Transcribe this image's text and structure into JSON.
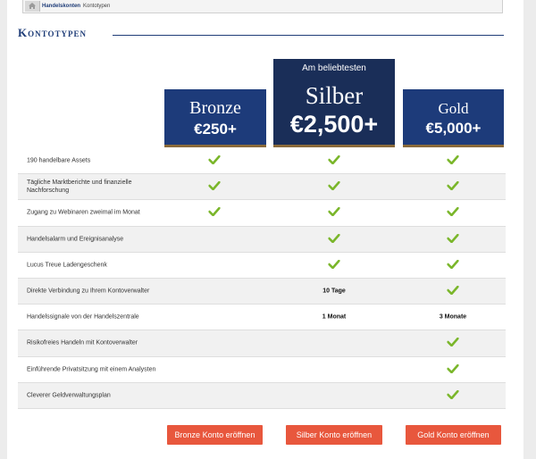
{
  "breadcrumb": {
    "items": [
      "Handelskonten",
      "Kontotypen"
    ]
  },
  "page_title": "Kontotypen",
  "tiers": [
    {
      "name": "Bronze",
      "price": "€250+"
    },
    {
      "name": "Silber",
      "price": "€2,500+",
      "ribbon": "Am beliebtesten"
    },
    {
      "name": "Gold",
      "price": "€5,000+"
    }
  ],
  "features": [
    {
      "label": "190 handelbare Assets",
      "values": [
        "check",
        "check",
        "check"
      ]
    },
    {
      "label": "Tägliche Marktberichte und finanzielle Nachforschung",
      "values": [
        "check",
        "check",
        "check"
      ]
    },
    {
      "label": "Zugang zu Webinaren zweimal im Monat",
      "values": [
        "check",
        "check",
        "check"
      ]
    },
    {
      "label": "Handelsalarm und Ereignisanalyse",
      "values": [
        "",
        "check",
        "check"
      ]
    },
    {
      "label": "Lucus Treue Ladengeschenk",
      "values": [
        "",
        "check",
        "check"
      ]
    },
    {
      "label": "Direkte Verbindung zu Ihrem Kontoverwalter",
      "values": [
        "",
        "10 Tage",
        "check"
      ]
    },
    {
      "label": "Handelssignale von der Handelszentrale",
      "values": [
        "",
        "1 Monat",
        "3 Monate"
      ]
    },
    {
      "label": "Risikofreies Handeln mit Kontoverwalter",
      "values": [
        "",
        "",
        "check"
      ]
    },
    {
      "label": "Einführende Privatsitzung mit einem Analysten",
      "values": [
        "",
        "",
        "check"
      ]
    },
    {
      "label": "Cleverer Geldverwaltungsplan",
      "values": [
        "",
        "",
        "check"
      ]
    }
  ],
  "buttons": [
    "Bronze Konto eröffnen",
    "Silber Konto eröffnen",
    "Gold Konto eröffnen"
  ],
  "colors": {
    "navy": "#1d3b7a",
    "check": "#7ab62a",
    "button": "#e8573d"
  }
}
